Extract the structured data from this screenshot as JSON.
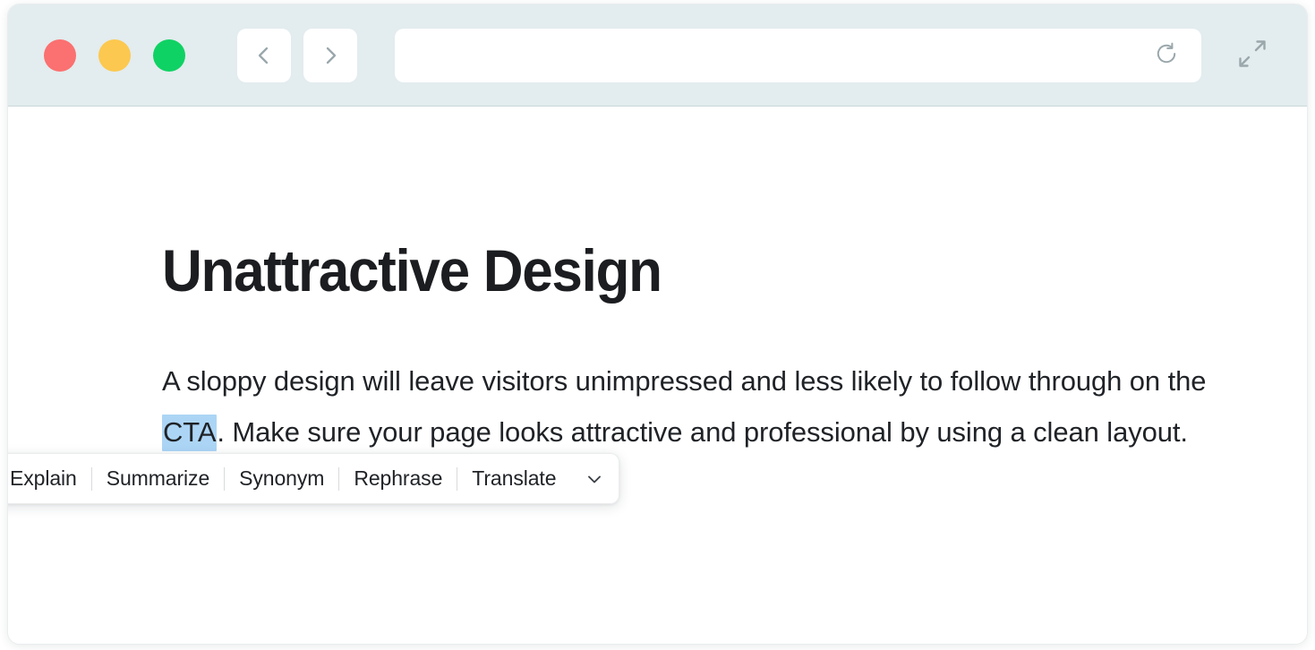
{
  "window": {
    "chrome": {
      "traffic_lights": [
        {
          "name": "close",
          "color": "#fb7070"
        },
        {
          "name": "minimize",
          "color": "#fcc84f"
        },
        {
          "name": "zoom",
          "color": "#0fd264"
        }
      ],
      "nav": {
        "back_icon": "chevron-left-icon",
        "forward_icon": "chevron-right-icon"
      },
      "address_bar": {
        "value": "",
        "placeholder": "",
        "reload_icon": "reload-icon"
      },
      "expand_icon": "expand-diagonal-icon"
    }
  },
  "page": {
    "title": "Unattractive Design",
    "paragraph": {
      "before_selection": "A sloppy design will leave visitors unimpressed and less likely to follow through on the ",
      "selection": "CTA",
      "after_selection": ". Make sure your page looks attractive and professional by using a clean layout."
    }
  },
  "ai_toolbar": {
    "logo_icon": "ai-assistant-face-icon",
    "logo_colors": {
      "start": "#9b4dff",
      "mid": "#3fa9f5",
      "end": "#12d39a"
    },
    "actions": [
      {
        "label": "Explain"
      },
      {
        "label": "Summarize"
      },
      {
        "label": "Synonym"
      },
      {
        "label": "Rephrase"
      },
      {
        "label": "Translate"
      }
    ],
    "chevron_icon": "chevron-down-icon"
  },
  "colors": {
    "chrome_bg": "#e3ecee",
    "page_bg": "#ffffff",
    "text": "#1f2226",
    "heading": "#1b1d20",
    "selection": "#acd5f5",
    "icon_gray": "#9aa7ac"
  }
}
